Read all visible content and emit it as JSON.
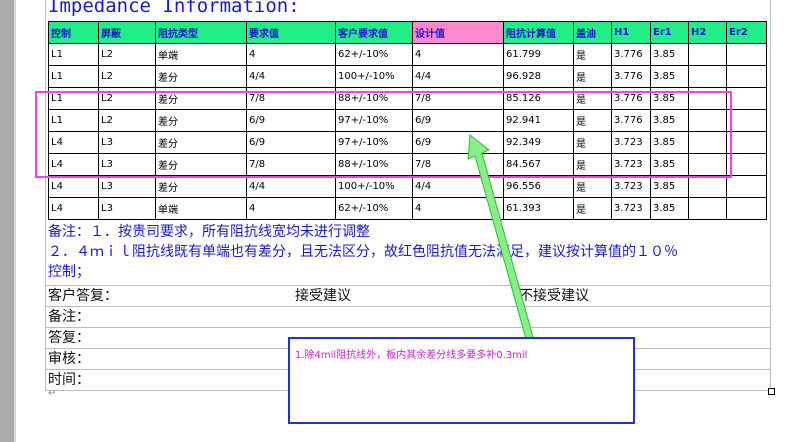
{
  "title": "Impedance Information:",
  "table": {
    "headers": [
      "控制",
      "屏蔽",
      "阻抗类型",
      "要求值",
      "客户要求值",
      "设计值",
      "阻抗计算值",
      "盖油",
      "H1",
      "Er1",
      "H2",
      "Er2"
    ],
    "rows": [
      [
        "L1",
        "L2",
        "单端",
        "4",
        "62+/-10%",
        "4",
        "61.799",
        "是",
        "3.776",
        "3.85",
        "",
        ""
      ],
      [
        "L1",
        "L2",
        "差分",
        "4/4",
        "100+/-10%",
        "4/4",
        "96.928",
        "是",
        "3.776",
        "3.85",
        "",
        ""
      ],
      [
        "L1",
        "L2",
        "差分",
        "7/8",
        "88+/-10%",
        "7/8",
        "85.126",
        "是",
        "3.776",
        "3.85",
        "",
        ""
      ],
      [
        "L1",
        "L2",
        "差分",
        "6/9",
        "97+/-10%",
        "6/9",
        "92.941",
        "是",
        "3.776",
        "3.85",
        "",
        ""
      ],
      [
        "L4",
        "L3",
        "差分",
        "6/9",
        "97+/-10%",
        "6/9",
        "92.349",
        "是",
        "3.723",
        "3.85",
        "",
        ""
      ],
      [
        "L4",
        "L3",
        "差分",
        "7/8",
        "88+/-10%",
        "7/8",
        "84.567",
        "是",
        "3.723",
        "3.85",
        "",
        ""
      ],
      [
        "L4",
        "L3",
        "差分",
        "4/4",
        "100+/-10%",
        "4/4",
        "96.556",
        "是",
        "3.723",
        "3.85",
        "",
        ""
      ],
      [
        "L4",
        "L3",
        "单端",
        "4",
        "62+/-10%",
        "4",
        "61.393",
        "是",
        "3.723",
        "3.85",
        "",
        ""
      ]
    ]
  },
  "notes": {
    "line1": "备注：１．按贵司要求，所有阻抗线宽均未进行调整",
    "line2": "２．４ｍｉｌ阻抗线既有单端也有差分，且无法区分，故红色阻抗值无法满足，建议按计算值的１０％",
    "line3": "控制；"
  },
  "form": {
    "customer_reply_label": "客户答复：",
    "accept_label": "接受建议",
    "reject_label": "不接受建议",
    "remark_label": "备注：",
    "answer_label": "答复：",
    "review_label": "审核：",
    "time_label": "时间："
  },
  "callout": {
    "text": "1.除4mil阻抗线外，板内其余差分线多要多补0.3mil"
  },
  "colors": {
    "header_green": "#22ee88",
    "header_pink": "#ff88cc",
    "title_blue": "#1a1acc",
    "highlight_magenta": "#ee44ee",
    "callout_blue": "#2233cc",
    "callout_text": "#cc22cc",
    "arrow_green": "#88ee88"
  }
}
